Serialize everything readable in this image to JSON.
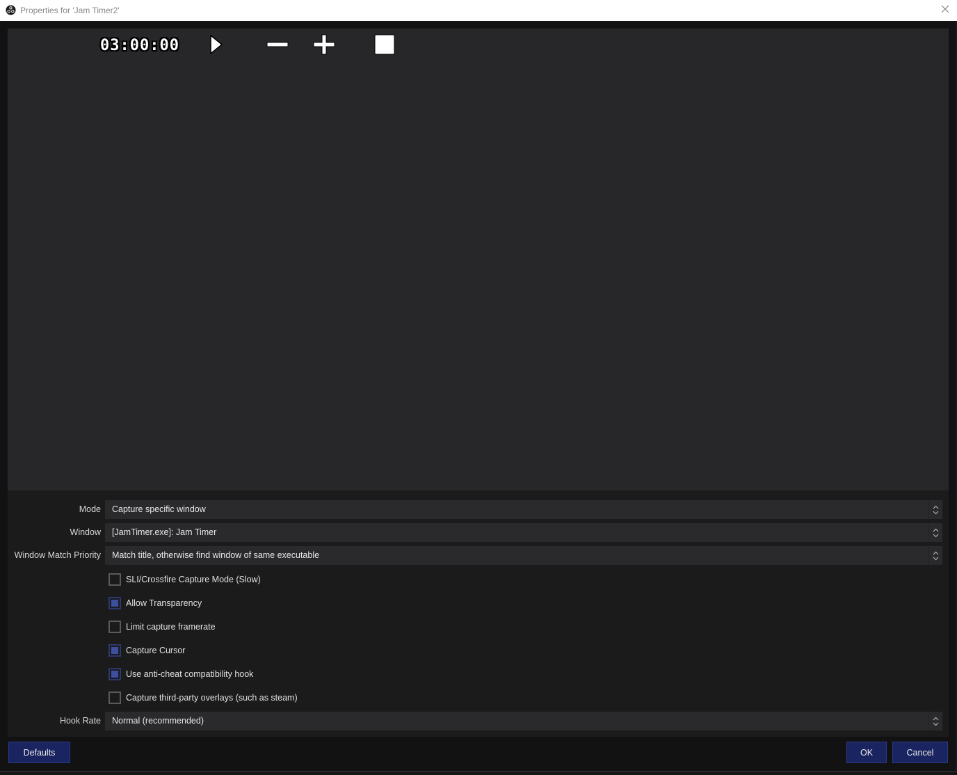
{
  "window": {
    "title": "Properties for 'Jam Timer2'",
    "icon": "obs-logo-icon",
    "close_icon": "close-icon"
  },
  "preview": {
    "timer_text": "03:00:00",
    "controls": [
      {
        "name": "play",
        "icon": "play-icon"
      },
      {
        "name": "decrease",
        "icon": "minus-icon"
      },
      {
        "name": "increase",
        "icon": "plus-icon"
      },
      {
        "name": "stop",
        "icon": "stop-square-icon"
      }
    ]
  },
  "form": {
    "mode": {
      "label": "Mode",
      "value": "Capture specific window"
    },
    "window": {
      "label": "Window",
      "value": "[JamTimer.exe]: Jam Timer"
    },
    "match_priority": {
      "label": "Window Match Priority",
      "value": "Match title, otherwise find window of same executable"
    },
    "checkboxes": [
      {
        "label": "SLI/Crossfire Capture Mode (Slow)",
        "checked": false
      },
      {
        "label": "Allow Transparency",
        "checked": true
      },
      {
        "label": "Limit capture framerate",
        "checked": false
      },
      {
        "label": "Capture Cursor",
        "checked": true
      },
      {
        "label": "Use anti-cheat compatibility hook",
        "checked": true
      },
      {
        "label": "Capture third-party overlays (such as steam)",
        "checked": false
      }
    ],
    "hook_rate": {
      "label": "Hook Rate",
      "value": "Normal (recommended)"
    }
  },
  "buttons": {
    "defaults": "Defaults",
    "ok": "OK",
    "cancel": "Cancel"
  },
  "colors": {
    "accent_button": "#1a2460",
    "checkbox_checked": "#3d4f9e",
    "preview_bg": "#27272a",
    "form_bg": "#1b1b1c",
    "window_bg": "#121212"
  }
}
